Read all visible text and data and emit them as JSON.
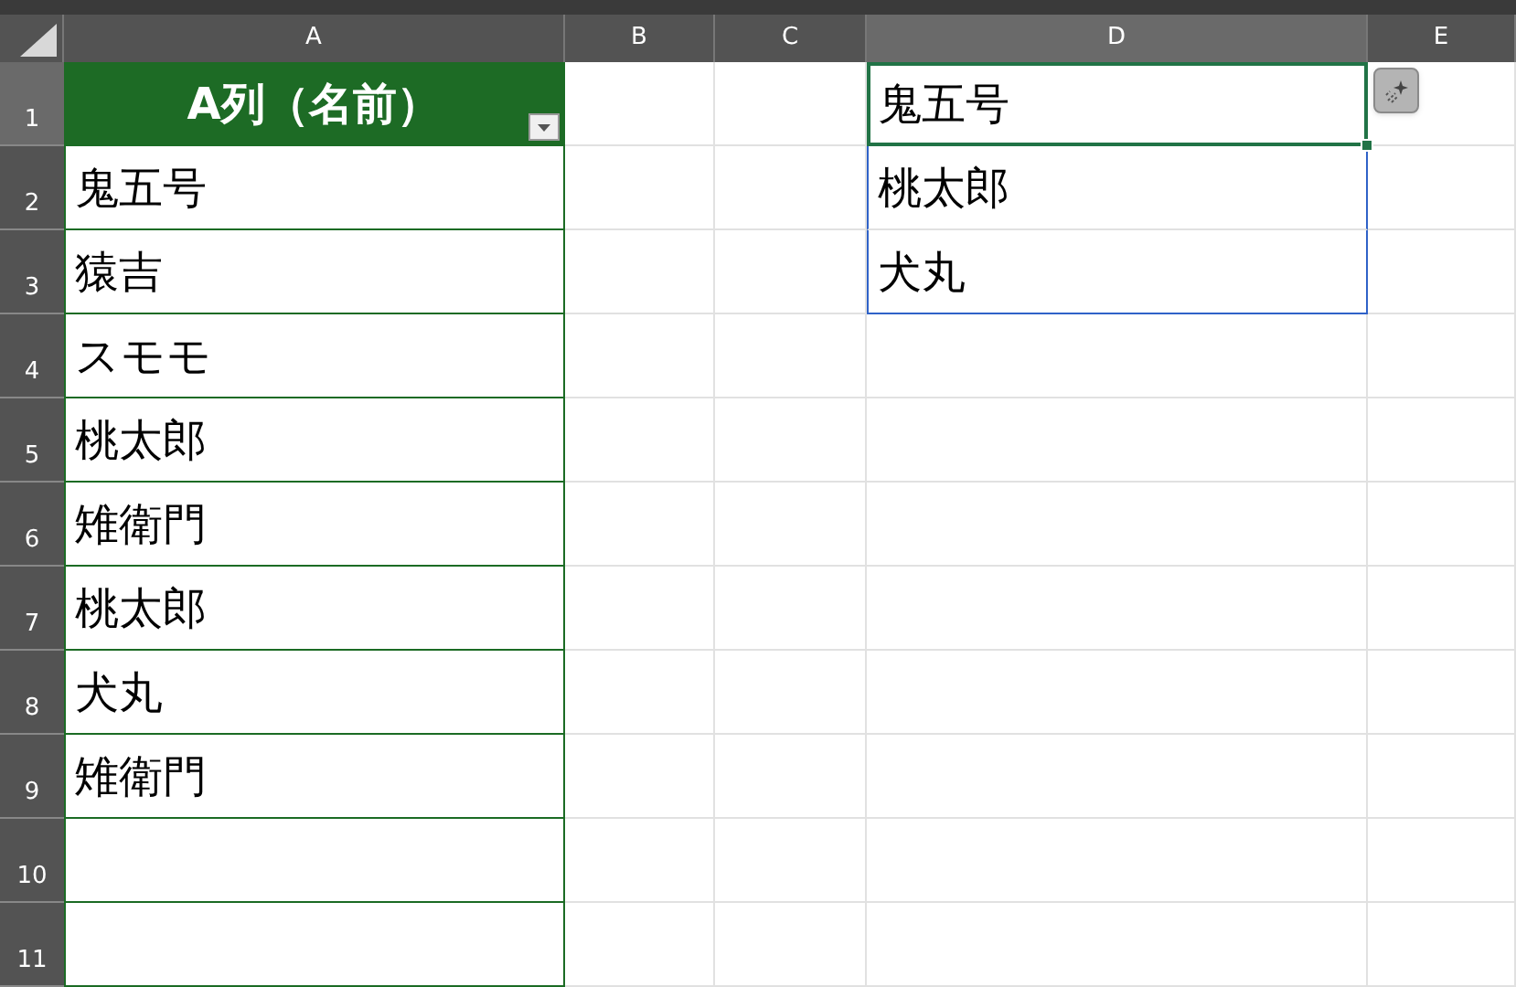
{
  "columns": [
    {
      "label": "A",
      "selected": false
    },
    {
      "label": "B",
      "selected": false
    },
    {
      "label": "C",
      "selected": false
    },
    {
      "label": "D",
      "selected": true
    },
    {
      "label": "E",
      "selected": false
    }
  ],
  "rows": [
    {
      "number": "1",
      "selected": true,
      "cells": {
        "A": {
          "text": "A列（名前）",
          "kind": "header",
          "filter": true
        },
        "D": {
          "text": "鬼五号",
          "spill": true,
          "active": true
        }
      }
    },
    {
      "number": "2",
      "selected": false,
      "cells": {
        "A": {
          "text": "鬼五号"
        },
        "D": {
          "text": "桃太郎",
          "spill": true,
          "active": false
        }
      }
    },
    {
      "number": "3",
      "selected": false,
      "cells": {
        "A": {
          "text": "猿吉"
        },
        "D": {
          "text": "犬丸",
          "spill": true,
          "active": false
        }
      }
    },
    {
      "number": "4",
      "selected": false,
      "cells": {
        "A": {
          "text": "スモモ"
        }
      }
    },
    {
      "number": "5",
      "selected": false,
      "cells": {
        "A": {
          "text": "桃太郎"
        }
      }
    },
    {
      "number": "6",
      "selected": false,
      "cells": {
        "A": {
          "text": "雉衛門"
        }
      }
    },
    {
      "number": "7",
      "selected": false,
      "cells": {
        "A": {
          "text": "桃太郎"
        }
      }
    },
    {
      "number": "8",
      "selected": false,
      "cells": {
        "A": {
          "text": "犬丸"
        }
      }
    },
    {
      "number": "9",
      "selected": false,
      "cells": {
        "A": {
          "text": "雉衛門"
        }
      }
    },
    {
      "number": "10",
      "selected": false,
      "cells": {}
    },
    {
      "number": "11",
      "selected": false,
      "cells": {}
    }
  ],
  "quick_analysis": {
    "visible": true
  }
}
